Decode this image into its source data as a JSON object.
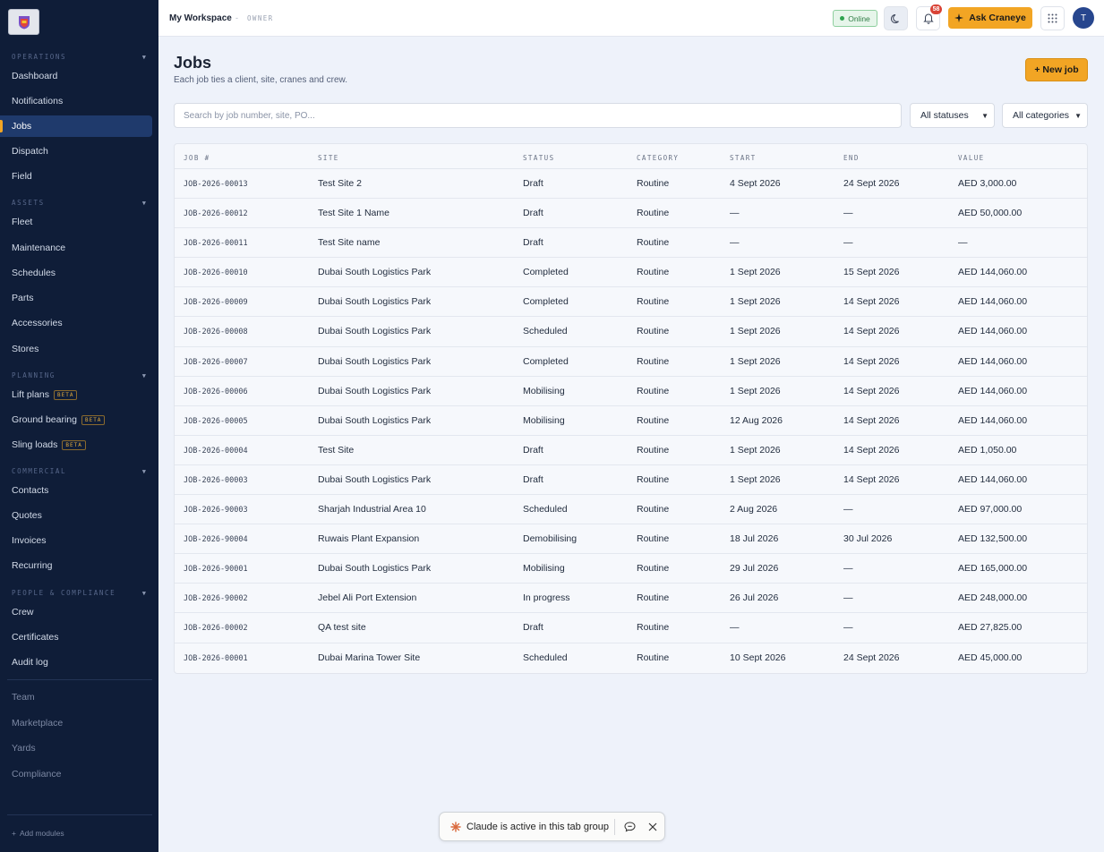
{
  "sidebar": {
    "sections": {
      "operations": "OPERATIONS",
      "assets": "ASSETS",
      "planning": "PLANNING",
      "commercial": "COMMERCIAL",
      "people": "PEOPLE & COMPLIANCE"
    },
    "items": {
      "dashboard": "Dashboard",
      "notifications": "Notifications",
      "jobs": "Jobs",
      "dispatch": "Dispatch",
      "field": "Field",
      "fleet": "Fleet",
      "maintenance": "Maintenance",
      "schedules": "Schedules",
      "parts": "Parts",
      "accessories": "Accessories",
      "stores": "Stores",
      "lift_plans": "Lift plans",
      "ground_bearing": "Ground bearing",
      "sling_loads": "Sling loads",
      "contacts": "Contacts",
      "quotes": "Quotes",
      "invoices": "Invoices",
      "recurring": "Recurring",
      "crew": "Crew",
      "certificates": "Certificates",
      "audit_log": "Audit log",
      "team": "Team",
      "marketplace": "Marketplace",
      "yards": "Yards",
      "compliance": "Compliance"
    },
    "beta_label": "BETA",
    "add_modules": "Add modules"
  },
  "topbar": {
    "workspace": "My Workspace",
    "separator": "-",
    "role": "OWNER",
    "status": "Online",
    "notification_count": "58",
    "ask_label": "Ask Craneye",
    "avatar_initial": "T"
  },
  "main": {
    "title": "Jobs",
    "subtitle": "Each job ties a client, site, cranes and crew.",
    "new_job_label": "+ New job",
    "search_placeholder": "Search by job number, site, PO...",
    "status_filter": "All statuses",
    "category_filter": "All categories",
    "columns": [
      "JOB #",
      "SITE",
      "STATUS",
      "CATEGORY",
      "START",
      "END",
      "VALUE"
    ],
    "rows": [
      [
        "JOB-2026-00013",
        "Test Site 2",
        "Draft",
        "Routine",
        "4 Sept 2026",
        "24 Sept 2026",
        "AED 3,000.00"
      ],
      [
        "JOB-2026-00012",
        "Test Site 1 Name",
        "Draft",
        "Routine",
        "—",
        "—",
        "AED 50,000.00"
      ],
      [
        "JOB-2026-00011",
        "Test Site name",
        "Draft",
        "Routine",
        "—",
        "—",
        "—"
      ],
      [
        "JOB-2026-00010",
        "Dubai South Logistics Park",
        "Completed",
        "Routine",
        "1 Sept 2026",
        "15 Sept 2026",
        "AED 144,060.00"
      ],
      [
        "JOB-2026-00009",
        "Dubai South Logistics Park",
        "Completed",
        "Routine",
        "1 Sept 2026",
        "14 Sept 2026",
        "AED 144,060.00"
      ],
      [
        "JOB-2026-00008",
        "Dubai South Logistics Park",
        "Scheduled",
        "Routine",
        "1 Sept 2026",
        "14 Sept 2026",
        "AED 144,060.00"
      ],
      [
        "JOB-2026-00007",
        "Dubai South Logistics Park",
        "Completed",
        "Routine",
        "1 Sept 2026",
        "14 Sept 2026",
        "AED 144,060.00"
      ],
      [
        "JOB-2026-00006",
        "Dubai South Logistics Park",
        "Mobilising",
        "Routine",
        "1 Sept 2026",
        "14 Sept 2026",
        "AED 144,060.00"
      ],
      [
        "JOB-2026-00005",
        "Dubai South Logistics Park",
        "Mobilising",
        "Routine",
        "12 Aug 2026",
        "14 Sept 2026",
        "AED 144,060.00"
      ],
      [
        "JOB-2026-00004",
        "Test Site",
        "Draft",
        "Routine",
        "1 Sept 2026",
        "14 Sept 2026",
        "AED 1,050.00"
      ],
      [
        "JOB-2026-00003",
        "Dubai South Logistics Park",
        "Draft",
        "Routine",
        "1 Sept 2026",
        "14 Sept 2026",
        "AED 144,060.00"
      ],
      [
        "JOB-2026-90003",
        "Sharjah Industrial Area 10",
        "Scheduled",
        "Routine",
        "2 Aug 2026",
        "—",
        "AED 97,000.00"
      ],
      [
        "JOB-2026-90004",
        "Ruwais Plant Expansion",
        "Demobilising",
        "Routine",
        "18 Jul 2026",
        "30 Jul 2026",
        "AED 132,500.00"
      ],
      [
        "JOB-2026-90001",
        "Dubai South Logistics Park",
        "Mobilising",
        "Routine",
        "29 Jul 2026",
        "—",
        "AED 165,000.00"
      ],
      [
        "JOB-2026-90002",
        "Jebel Ali Port Extension",
        "In progress",
        "Routine",
        "26 Jul 2026",
        "—",
        "AED 248,000.00"
      ],
      [
        "JOB-2026-00002",
        "QA test site",
        "Draft",
        "Routine",
        "—",
        "—",
        "AED 27,825.00"
      ],
      [
        "JOB-2026-00001",
        "Dubai Marina Tower Site",
        "Scheduled",
        "Routine",
        "10 Sept 2026",
        "24 Sept 2026",
        "AED 45,000.00"
      ]
    ]
  },
  "claude_bar": {
    "text": "Claude is active in this tab group"
  },
  "colors": {
    "sidebar_bg": "#0f1d38",
    "accent": "#f2a524",
    "active_nav": "#1f3a6c",
    "badge": "#d94437",
    "online": "#2fa34f"
  },
  "icons": [
    "logo-icon",
    "chevron-down-icon",
    "moon-icon",
    "bell-icon",
    "sparkle-icon",
    "apps-grid-icon",
    "plus-icon",
    "claude-star-icon",
    "chat-icon",
    "close-icon"
  ]
}
